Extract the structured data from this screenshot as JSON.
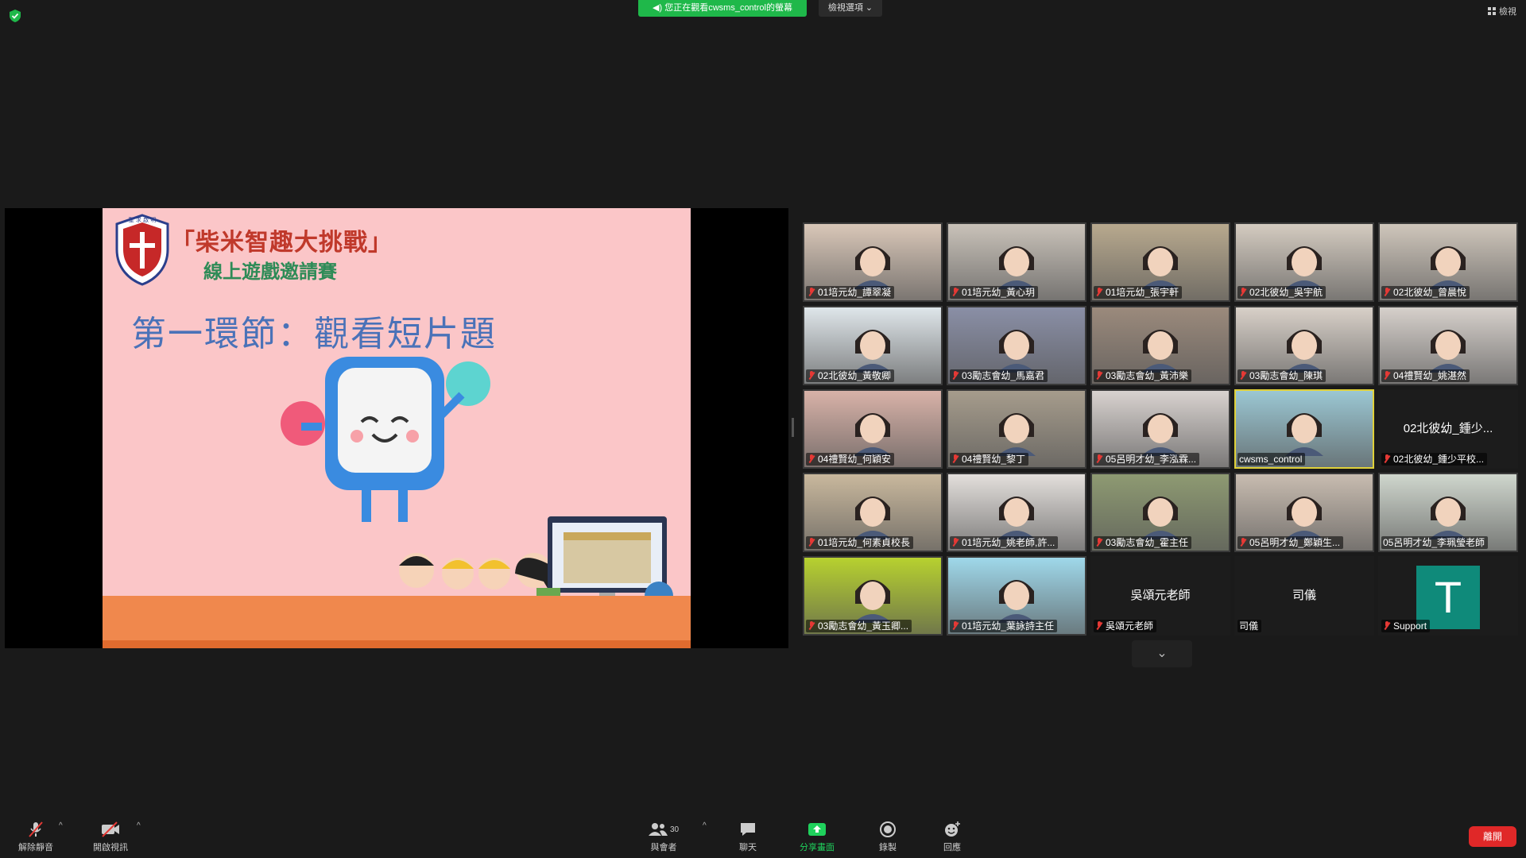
{
  "topbar": {
    "share_notice": "您正在觀看cwsms_control的螢幕",
    "view_options": "檢視選項 ⌄",
    "view_label": "檢視"
  },
  "slide": {
    "title": "「柴米智趣大挑戰」",
    "subtitle": "線上遊戲邀請賽",
    "heading": "第一環節：觀看短片題"
  },
  "participants": [
    {
      "name": "01培元幼_譚翠凝",
      "muted": true,
      "bg": "#d9c7b8"
    },
    {
      "name": "01培元幼_黃心玥",
      "muted": true,
      "bg": "#c9c2b9"
    },
    {
      "name": "01培元幼_張宇軒",
      "muted": true,
      "bg": "#b8a98e"
    },
    {
      "name": "02北彼幼_吳宇航",
      "muted": true,
      "bg": "#d4cbc0"
    },
    {
      "name": "02北彼幼_曾晨悅",
      "muted": true,
      "bg": "#cfc6bb"
    },
    {
      "name": "02北彼幼_黃敬卿",
      "muted": true,
      "bg": "#dfe6ea"
    },
    {
      "name": "03勵志會幼_馬嘉君",
      "muted": true,
      "bg": "#8a8fa6"
    },
    {
      "name": "03勵志會幼_黃沛樂",
      "muted": true,
      "bg": "#9b8a7c"
    },
    {
      "name": "03勵志會幼_陳琪",
      "muted": true,
      "bg": "#d8d0c8"
    },
    {
      "name": "04禮賢幼_姚湛然",
      "muted": true,
      "bg": "#d6d0cb"
    },
    {
      "name": "04禮賢幼_何穎安",
      "muted": true,
      "bg": "#d8b2a8"
    },
    {
      "name": "04禮賢幼_黎丁",
      "muted": true,
      "bg": "#a69c8c"
    },
    {
      "name": "05呂明才幼_李泓霖...",
      "muted": true,
      "bg": "#d8d2cf"
    },
    {
      "name": "cwsms_control",
      "muted": false,
      "bg": "#9bc7d3",
      "active": true
    },
    {
      "name": "02北彼幼_鍾少平校...",
      "muted": true,
      "bg": "",
      "center": "02北彼幼_鍾少..."
    },
    {
      "name": "01培元幼_何素貞校長",
      "muted": true,
      "bg": "#c9b89d"
    },
    {
      "name": "01培元幼_姚老師,許...",
      "muted": true,
      "bg": "#e3dfdc"
    },
    {
      "name": "03勵志會幼_霍主任",
      "muted": true,
      "bg": "#8e9a72"
    },
    {
      "name": "05呂明才幼_鄭穎生...",
      "muted": true,
      "bg": "#c8bcb0"
    },
    {
      "name": "05呂明才幼_李珮瑩老師",
      "muted": false,
      "bg": "#cfd6cd"
    },
    {
      "name": "03勵志會幼_黃玉卿...",
      "muted": true,
      "bg": "#b7d12f"
    },
    {
      "name": "01培元幼_葉詠詩主任",
      "muted": true,
      "bg": "#9fd8ea"
    },
    {
      "name": "吳頌元老師",
      "muted": true,
      "bg": "",
      "center": "吳頌元老師"
    },
    {
      "name": "司儀",
      "muted": false,
      "bg": "",
      "center": "司儀"
    },
    {
      "name": "Support",
      "muted": true,
      "bg": "",
      "avatar": "T"
    }
  ],
  "toolbar": {
    "unmute": "解除靜音",
    "start_video": "開啟視訊",
    "participants": "與會者",
    "participants_count": "30",
    "chat": "聊天",
    "share_screen": "分享畫面",
    "record": "錄製",
    "reactions": "回應",
    "leave": "離開"
  },
  "colors": {
    "accent_green": "#1fb84a",
    "active_border": "#e0d13a",
    "leave_red": "#e02828",
    "avatar_teal": "#0f8a7a"
  }
}
